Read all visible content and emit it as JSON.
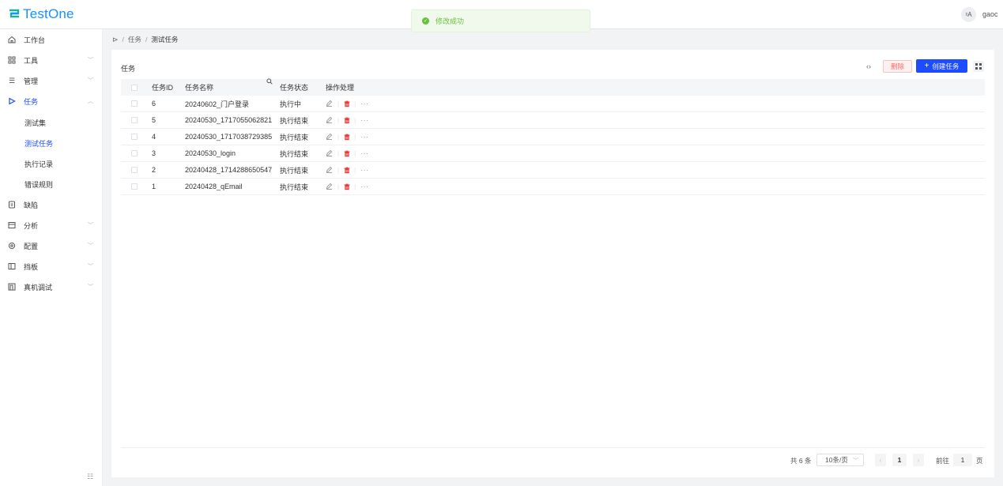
{
  "app": {
    "brand": "TestOne",
    "lang_icon": "translate-icon",
    "user": "gaoc"
  },
  "toast": {
    "text": "修改成功",
    "icon": "success-check-icon"
  },
  "sidebar": {
    "items": [
      {
        "label": "工作台",
        "icon": "home-icon"
      },
      {
        "label": "工具",
        "icon": "grid-apps-icon"
      },
      {
        "label": "管理",
        "icon": "list-icon"
      },
      {
        "label": "任务",
        "icon": "play-icon"
      },
      {
        "label": "缺陷",
        "icon": "bug-doc-icon"
      },
      {
        "label": "分析",
        "icon": "calendar-icon"
      },
      {
        "label": "配置",
        "icon": "settings-icon"
      },
      {
        "label": "挡板",
        "icon": "panel-icon"
      },
      {
        "label": "真机调试",
        "icon": "device-icon"
      }
    ],
    "sub_items": [
      {
        "label": "测试集"
      },
      {
        "label": "测试任务"
      },
      {
        "label": "执行记录"
      },
      {
        "label": "错误规则"
      }
    ]
  },
  "breadcrumb": {
    "level1": "任务",
    "level2": "测试任务"
  },
  "card": {
    "title": "任务",
    "delete_label": "删除",
    "create_label": "创建任务"
  },
  "table": {
    "headers": {
      "id": "任务ID",
      "name": "任务名称",
      "status": "任务状态",
      "ops": "操作处理"
    },
    "rows": [
      {
        "id": "6",
        "name": "20240602_门户登录",
        "status": "执行中"
      },
      {
        "id": "5",
        "name": "20240530_1717055062821",
        "status": "执行结束"
      },
      {
        "id": "4",
        "name": "20240530_1717038729385",
        "status": "执行结束"
      },
      {
        "id": "3",
        "name": "20240530_login",
        "status": "执行结束"
      },
      {
        "id": "2",
        "name": "20240428_1714288650547",
        "status": "执行结束"
      },
      {
        "id": "1",
        "name": "20240428_qEmail",
        "status": "执行结束"
      }
    ]
  },
  "pagination": {
    "total": "共 6 条",
    "page_size": "10条/页",
    "current_page": "1",
    "goto_label": "前往",
    "goto_value": "1",
    "unit": "页"
  },
  "colors": {
    "primary": "#1d4bff",
    "danger": "#f56c6c",
    "success": "#67c23a"
  }
}
